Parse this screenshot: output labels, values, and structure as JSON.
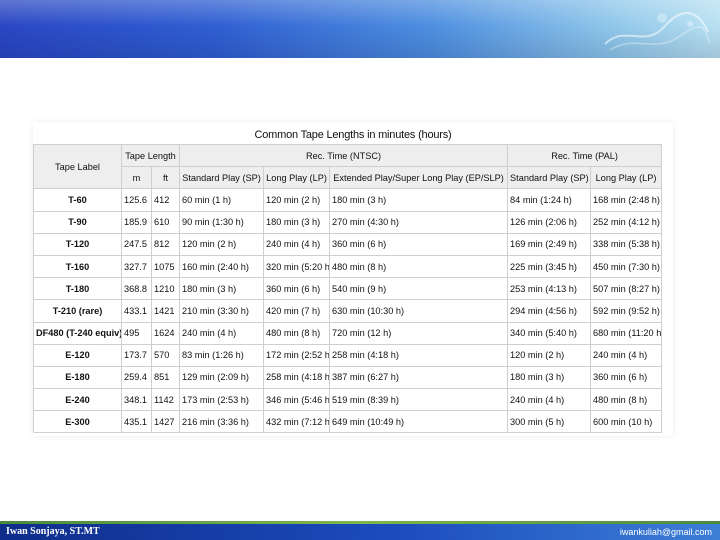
{
  "table": {
    "title": "Common Tape Lengths in minutes (hours)",
    "headers": {
      "tape_label": "Tape Label",
      "tape_length": "Tape Length",
      "rec_ntsc": "Rec. Time (NTSC)",
      "rec_pal": "Rec. Time (PAL)",
      "m": "m",
      "ft": "ft",
      "sp": "Standard Play (SP)",
      "lp": "Long Play (LP)",
      "ep": "Extended Play/Super Long Play (EP/SLP)",
      "pal_sp": "Standard Play (SP)",
      "pal_lp": "Long Play (LP)"
    },
    "rows": [
      [
        "T-60",
        "125.6",
        "412",
        "60 min (1 h)",
        "120 min (2 h)",
        "180 min (3 h)",
        "84 min (1:24 h)",
        "168 min (2:48 h)"
      ],
      [
        "T-90",
        "185.9",
        "610",
        "90 min (1:30 h)",
        "180 min (3 h)",
        "270 min (4:30 h)",
        "126 min (2:06 h)",
        "252 min (4:12 h)"
      ],
      [
        "T-120",
        "247.5",
        "812",
        "120 min (2 h)",
        "240 min (4 h)",
        "360 min (6 h)",
        "169 min (2:49 h)",
        "338 min (5:38 h)"
      ],
      [
        "T-160",
        "327.7",
        "1075",
        "160 min (2:40 h)",
        "320 min (5:20 h)",
        "480 min (8 h)",
        "225 min (3:45 h)",
        "450 min (7:30 h)"
      ],
      [
        "T-180",
        "368.8",
        "1210",
        "180 min (3 h)",
        "360 min (6 h)",
        "540 min (9 h)",
        "253 min (4:13 h)",
        "507 min (8:27 h)"
      ],
      [
        "T-210 (rare)",
        "433.1",
        "1421",
        "210 min (3:30 h)",
        "420 min (7 h)",
        "630 min (10:30 h)",
        "294 min (4:56 h)",
        "592 min (9:52 h)"
      ],
      [
        "DF480 (T-240 equiv)",
        "495",
        "1624",
        "240 min (4 h)",
        "480 min (8 h)",
        "720 min (12 h)",
        "340 min (5:40 h)",
        "680 min (11:20 h)"
      ],
      [
        "E-120",
        "173.7",
        "570",
        "83 min (1:26 h)",
        "172 min (2:52 h)",
        "258 min (4:18 h)",
        "120 min (2 h)",
        "240 min (4 h)"
      ],
      [
        "E-180",
        "259.4",
        "851",
        "129 min (2:09 h)",
        "258 min (4:18 h)",
        "387 min (6:27 h)",
        "180 min (3 h)",
        "360 min (6 h)"
      ],
      [
        "E-240",
        "348.1",
        "1142",
        "173 min (2:53 h)",
        "346 min (5:46 h)",
        "519 min (8:39 h)",
        "240 min (4 h)",
        "480 min (8 h)"
      ],
      [
        "E-300",
        "435.1",
        "1427",
        "216 min (3:36 h)",
        "432 min (7:12 h)",
        "649 min (10:49 h)",
        "300 min (5 h)",
        "600 min (10 h)"
      ]
    ]
  },
  "footer": {
    "author": "Iwan Sonjaya, ST.MT",
    "email": "iwankuliah@gmail.com"
  },
  "colors": {
    "banner_start": "#2a47c4",
    "banner_end": "#b9e1f2",
    "footer_bar": "#1c4cbe",
    "header_bg": "#eeeeee"
  }
}
